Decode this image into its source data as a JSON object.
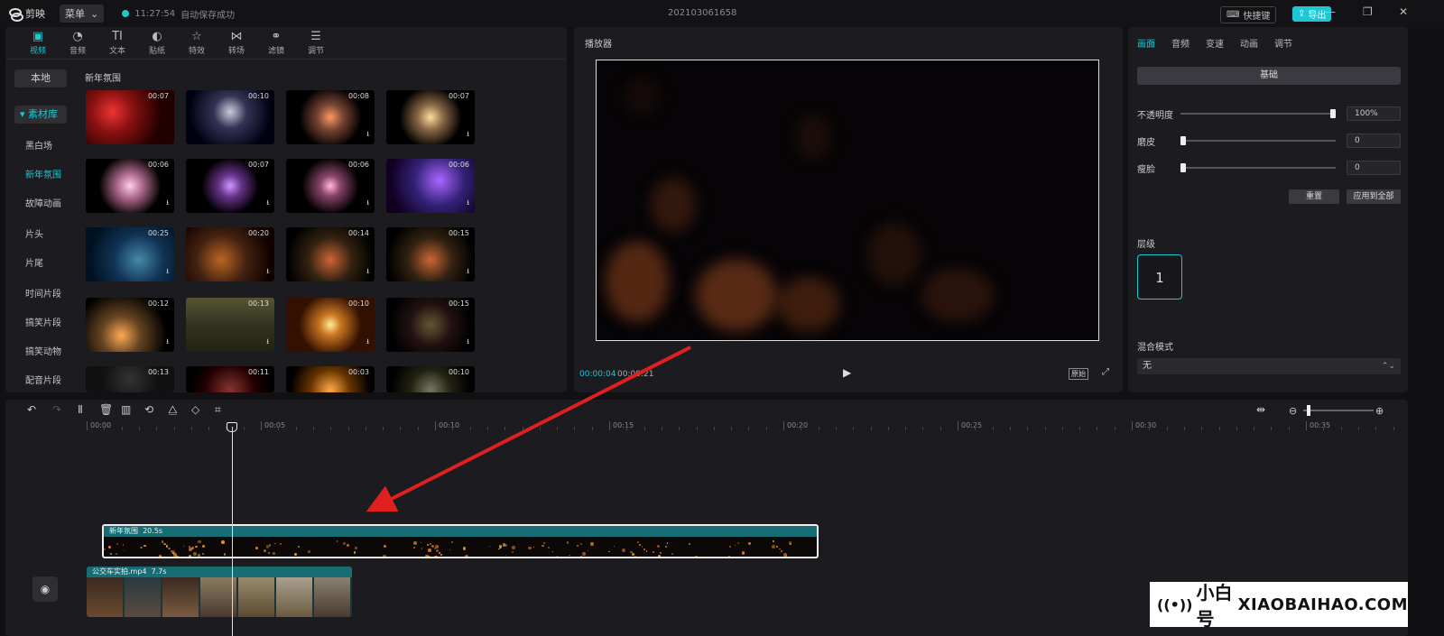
{
  "app": {
    "name": "剪映",
    "menu_label": "菜单",
    "save_time": "11:27:54",
    "save_status": "自动保存成功",
    "project_title": "202103061658",
    "shortcut_label": "快捷键",
    "export_label": "导出"
  },
  "media": {
    "tabs": [
      {
        "label": "视频",
        "icon": "video-icon"
      },
      {
        "label": "音频",
        "icon": "audio-icon"
      },
      {
        "label": "文本",
        "icon": "text-icon"
      },
      {
        "label": "贴纸",
        "icon": "sticker-icon"
      },
      {
        "label": "特效",
        "icon": "effects-icon"
      },
      {
        "label": "转场",
        "icon": "transition-icon"
      },
      {
        "label": "滤镜",
        "icon": "filter-icon"
      },
      {
        "label": "调节",
        "icon": "adjust-icon"
      }
    ],
    "local_label": "本地",
    "library_label": "素材库",
    "categories": [
      "黑白场",
      "新年氛围",
      "故障动画",
      "片头",
      "片尾",
      "时间片段",
      "搞笑片段",
      "搞笑动物",
      "配音片段"
    ],
    "active_category": "新年氛围",
    "grid_title": "新年氛围",
    "durations": [
      "00:07",
      "00:10",
      "00:08",
      "00:07",
      "00:06",
      "00:07",
      "00:06",
      "00:06",
      "00:25",
      "00:20",
      "00:14",
      "00:15",
      "00:12",
      "00:13",
      "00:10",
      "00:15",
      "00:13",
      "00:11",
      "00:03",
      "00:10"
    ]
  },
  "player": {
    "title": "播放器",
    "current_time": "00:00:04",
    "total_time": "00:00:21",
    "ratio_label": "原始"
  },
  "props": {
    "tabs": [
      "画面",
      "音频",
      "变速",
      "动画",
      "调节"
    ],
    "basic_label": "基础",
    "opacity_label": "不透明度",
    "opacity_value": "100%",
    "opacity_level": 1.0,
    "smooth_label": "磨皮",
    "smooth_value": "0",
    "smooth_level": 0,
    "slim_label": "瘦脸",
    "slim_value": "0",
    "slim_level": 0,
    "reset_label": "重置",
    "apply_all_label": "应用到全部",
    "layer_label": "层级",
    "layer_value": "1",
    "blend_label": "混合模式",
    "blend_value": "无"
  },
  "timeline": {
    "ticks": [
      "00:00",
      "00:05",
      "00:10",
      "00:15",
      "00:20",
      "00:25",
      "00:30",
      "00:35"
    ],
    "main_clip_name": "新年氛围",
    "main_clip_dur": "20.5s",
    "sub_clip_name": "公交车实拍.mp4",
    "sub_clip_dur": "7.7s"
  },
  "watermark": {
    "cn": "小白号",
    "en": "XIAOBAIHAO.COM"
  },
  "colors": {
    "accent": "#1fc7d3",
    "arrow": "#e02020",
    "clip": "#176d73"
  }
}
